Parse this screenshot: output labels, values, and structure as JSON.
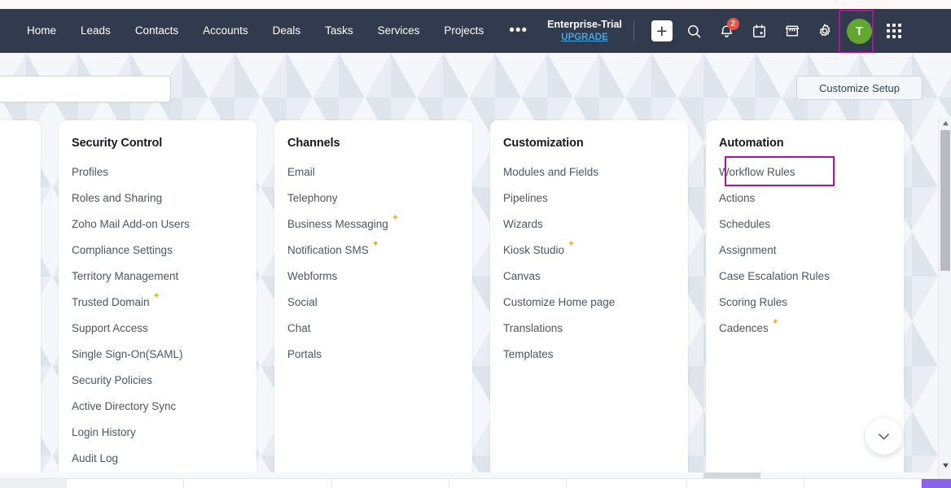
{
  "topnav": {
    "modules": [
      {
        "label": "Home"
      },
      {
        "label": "Leads"
      },
      {
        "label": "Contacts"
      },
      {
        "label": "Accounts"
      },
      {
        "label": "Deals"
      },
      {
        "label": "Tasks"
      },
      {
        "label": "Services"
      },
      {
        "label": "Projects"
      }
    ],
    "more_label": "•••",
    "trial_name": "Enterprise-Trial",
    "upgrade_label": "UPGRADE",
    "plus_label": "+",
    "notification_count": "2",
    "avatar_initial": "T",
    "icons": {
      "add": "plus-icon",
      "search": "search-icon",
      "notifications": "bell-icon",
      "calendar": "calendar-icon",
      "marketplace": "shop-icon",
      "settings": "gear-icon",
      "apps": "apps-grid-icon"
    },
    "colors": {
      "bar_background": "#323a4d",
      "upgrade_link": "#44a5e0",
      "badge": "#e8504a",
      "avatar": "#62a830",
      "highlight": "#a7179e"
    }
  },
  "toolbar": {
    "search_value": "",
    "search_placeholder": "",
    "customize_setup_label": "Customize Setup"
  },
  "columns": [
    {
      "title": "Security Control",
      "items": [
        {
          "label": "Profiles",
          "new": false
        },
        {
          "label": "Roles and Sharing",
          "new": false
        },
        {
          "label": "Zoho Mail Add-on Users",
          "new": false
        },
        {
          "label": "Compliance Settings",
          "new": false
        },
        {
          "label": "Territory Management",
          "new": false
        },
        {
          "label": "Trusted Domain",
          "new": true
        },
        {
          "label": "Support Access",
          "new": false
        },
        {
          "label": "Single Sign-On(SAML)",
          "new": false
        },
        {
          "label": "Security Policies",
          "new": false
        },
        {
          "label": "Active Directory Sync",
          "new": false
        },
        {
          "label": "Login History",
          "new": false
        },
        {
          "label": "Audit Log",
          "new": false
        }
      ]
    },
    {
      "title": "Channels",
      "items": [
        {
          "label": "Email",
          "new": false
        },
        {
          "label": "Telephony",
          "new": false
        },
        {
          "label": "Business Messaging",
          "new": true
        },
        {
          "label": "Notification SMS",
          "new": true
        },
        {
          "label": "Webforms",
          "new": false
        },
        {
          "label": "Social",
          "new": false
        },
        {
          "label": "Chat",
          "new": false
        },
        {
          "label": "Portals",
          "new": false
        }
      ]
    },
    {
      "title": "Customization",
      "items": [
        {
          "label": "Modules and Fields",
          "new": false
        },
        {
          "label": "Pipelines",
          "new": false
        },
        {
          "label": "Wizards",
          "new": false
        },
        {
          "label": "Kiosk Studio",
          "new": true
        },
        {
          "label": "Canvas",
          "new": false
        },
        {
          "label": "Customize Home page",
          "new": false
        },
        {
          "label": "Translations",
          "new": false
        },
        {
          "label": "Templates",
          "new": false
        }
      ]
    },
    {
      "title": "Automation",
      "items": [
        {
          "label": "Workflow Rules",
          "new": false
        },
        {
          "label": "Actions",
          "new": false
        },
        {
          "label": "Schedules",
          "new": false
        },
        {
          "label": "Assignment",
          "new": false
        },
        {
          "label": "Case Escalation Rules",
          "new": false
        },
        {
          "label": "Scoring Rules",
          "new": false
        },
        {
          "label": "Cadences",
          "new": true
        }
      ]
    }
  ],
  "overlays": {
    "highlighted_gear": "gear-icon",
    "highlighted_item": "Workflow Rules"
  },
  "fab": {
    "icon": "chevron-down-icon"
  },
  "sparkle_glyph": "✦"
}
